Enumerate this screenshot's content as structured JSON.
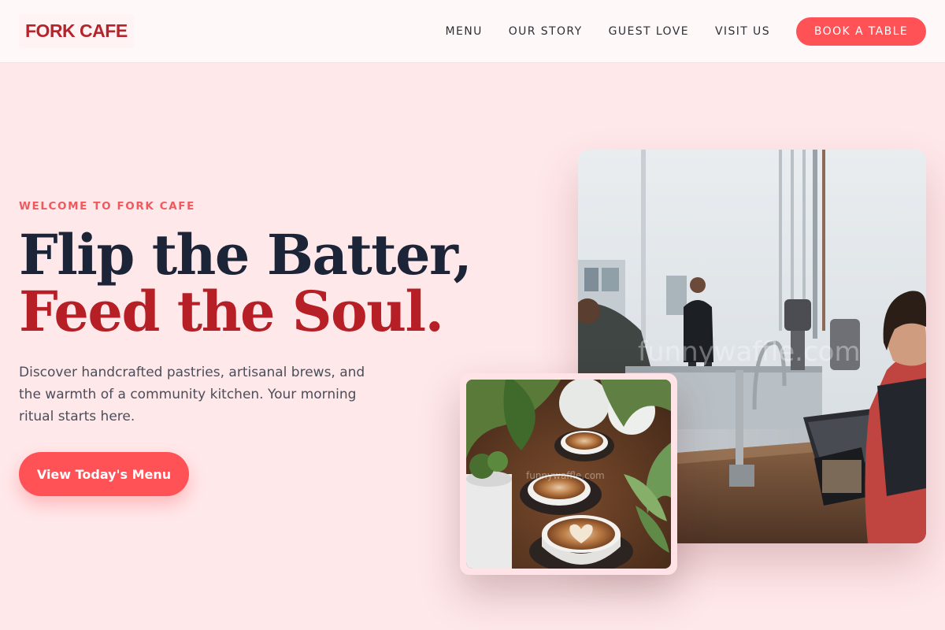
{
  "nav": {
    "logo": "FORK CAFE",
    "links": [
      {
        "label": "MENU"
      },
      {
        "label": "OUR STORY"
      },
      {
        "label": "GUEST LOVE"
      },
      {
        "label": "VISIT US"
      }
    ],
    "cta": "BOOK A TABLE"
  },
  "hero": {
    "eyebrow": "WELCOME TO FORK CAFE",
    "headline_line1": "Flip the Batter,",
    "headline_line2": "Feed the Soul.",
    "description": "Discover handcrafted pastries, artisanal brews, and the warmth of a community kitchen. Your morning ritual starts here.",
    "cta": "View Today's Menu"
  },
  "images": {
    "main_watermark": "funnywaffle.com",
    "inset_watermark": "funnywaffle.com"
  },
  "colors": {
    "accent": "#ff5257",
    "brand_red": "#b5232b",
    "navy": "#1c2537",
    "background": "#ffe8ea"
  }
}
